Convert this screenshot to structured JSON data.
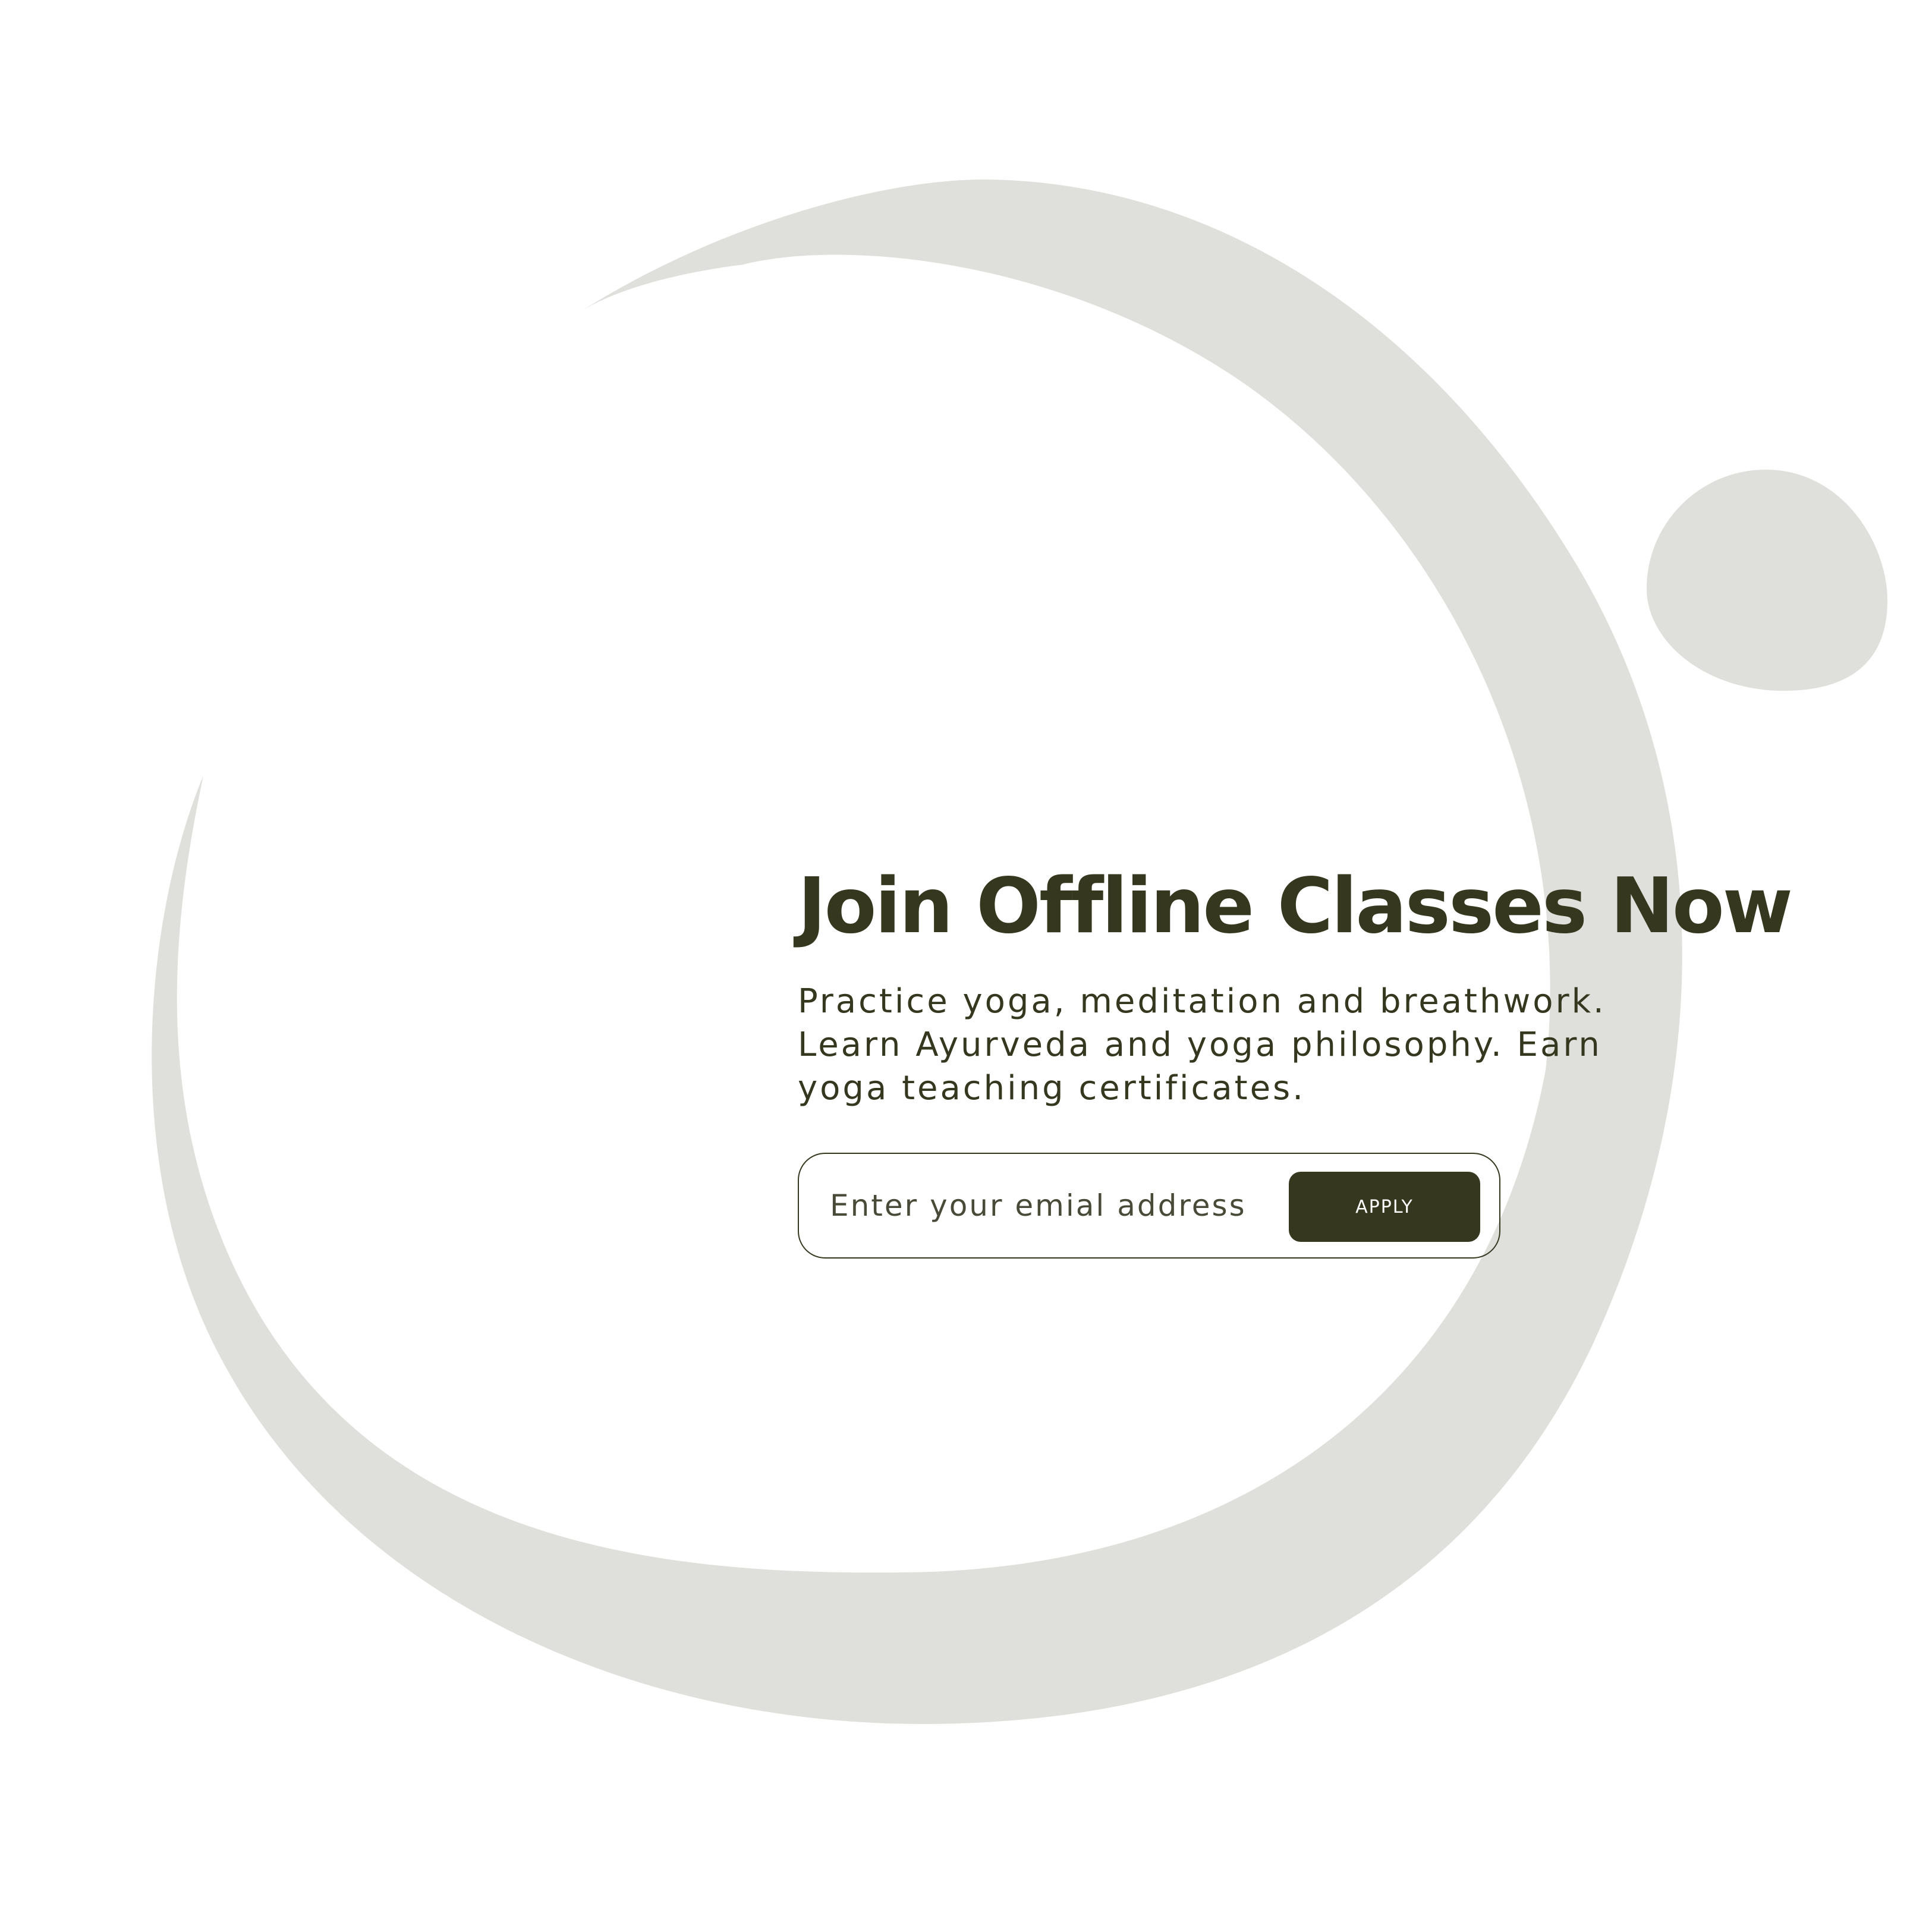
{
  "hero": {
    "title": "Join Offline Classes Now",
    "description": "Practice yoga, meditation and breathwork. Learn Ayurveda and yoga philosophy. Earn yoga teaching certificates."
  },
  "signup": {
    "email_value": "",
    "email_placeholder": "Enter your emial address",
    "apply_label": "APPLY"
  },
  "colors": {
    "background": "#ffffff",
    "accent_dark": "#36371f",
    "decor_gray": "#dfe0db"
  }
}
